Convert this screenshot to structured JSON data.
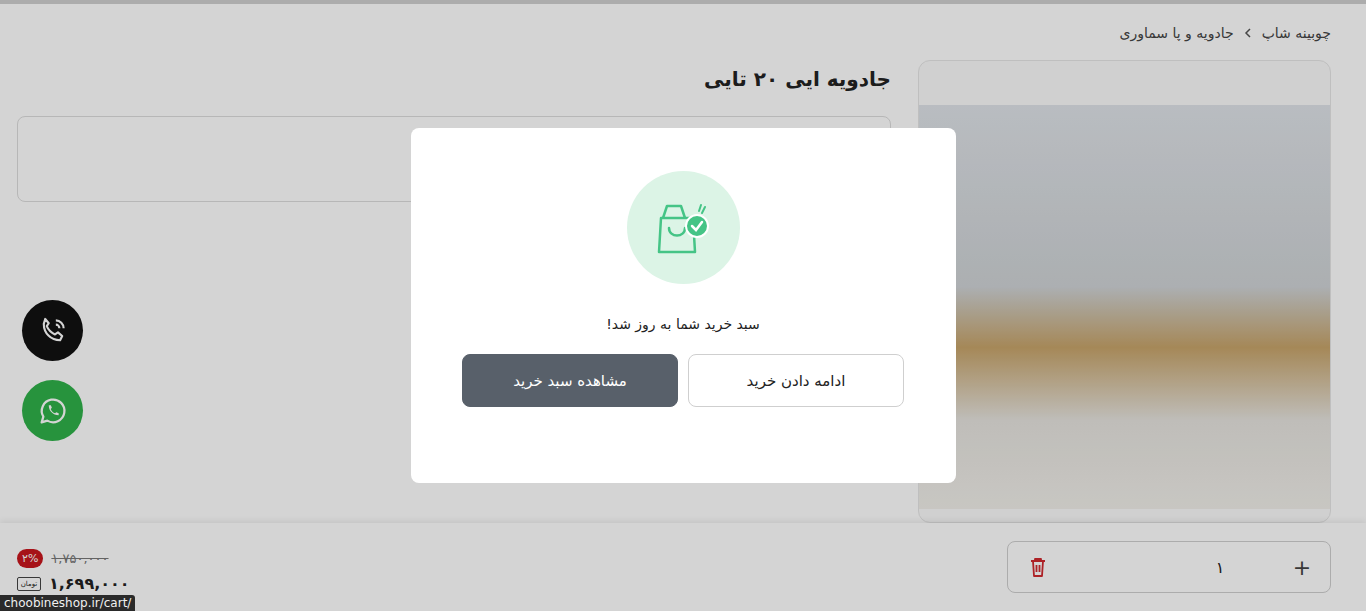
{
  "breadcrumb": [
    {
      "label": "چوبینه شاپ"
    },
    {
      "label": "جادویه و پا سماوری"
    }
  ],
  "product": {
    "title": "جادویه ایی ۲۰ تایی"
  },
  "purchase_bar": {
    "increment": "+",
    "quantity": "۱",
    "discount_badge": "۲%",
    "old_price": "۱,۷۵۰,۰۰۰",
    "price": "۱,۶۹۹,۰۰۰",
    "currency": "تومان"
  },
  "modal": {
    "message": "سبد خرید شما به روز شد!",
    "buttons": [
      {
        "label": "ادامه دادن خرید",
        "primary": false
      },
      {
        "label": "مشاهده سبد خرید",
        "primary": true
      }
    ]
  },
  "status_bar": {
    "url": "choobineshop.ir/cart/"
  }
}
